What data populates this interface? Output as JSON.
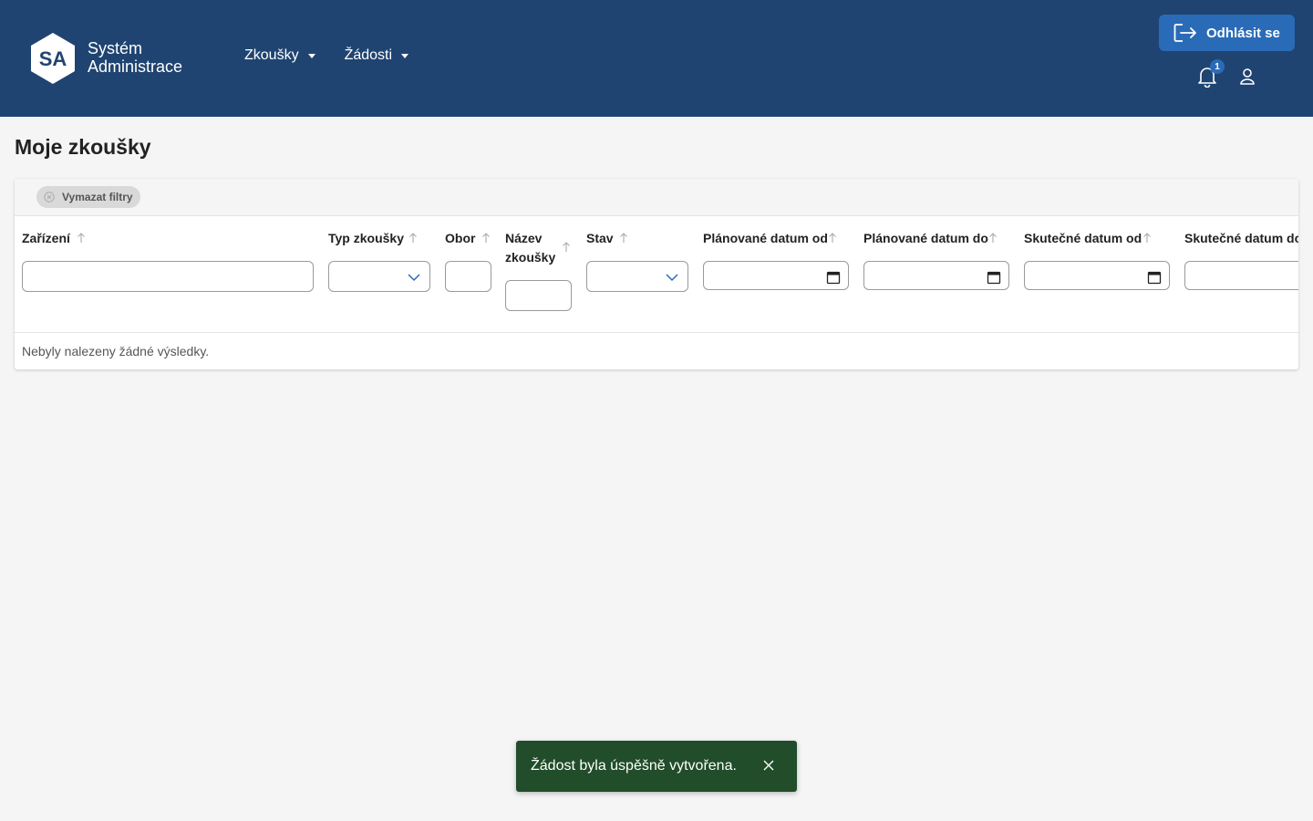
{
  "header": {
    "logo_text": "SA",
    "brand_line1": "Systém",
    "brand_line2": "Administrace",
    "nav": [
      {
        "label": "Zkoušky"
      },
      {
        "label": "Žádosti"
      }
    ],
    "logout_label": "Odhlásit se",
    "notification_count": "1"
  },
  "page": {
    "title": "Moje zkoušky"
  },
  "table": {
    "clear_filters_label": "Vymazat filtry",
    "columns": [
      {
        "label": "Zařízení"
      },
      {
        "label": "Typ zkoušky"
      },
      {
        "label": "Obor"
      },
      {
        "label": "Název zkoušky"
      },
      {
        "label": "Stav"
      },
      {
        "label": "Plánované datum od"
      },
      {
        "label": "Plánované datum do"
      },
      {
        "label": "Skutečné datum od"
      },
      {
        "label": "Skutečné datum do"
      }
    ],
    "empty_message": "Nebyly nalezeny žádné výsledky."
  },
  "toast": {
    "message": "Žádost byla úspěšně vytvořena."
  },
  "colors": {
    "header_bg": "#1f4471",
    "accent": "#2a6bb8",
    "toast_bg": "#214d2a"
  }
}
